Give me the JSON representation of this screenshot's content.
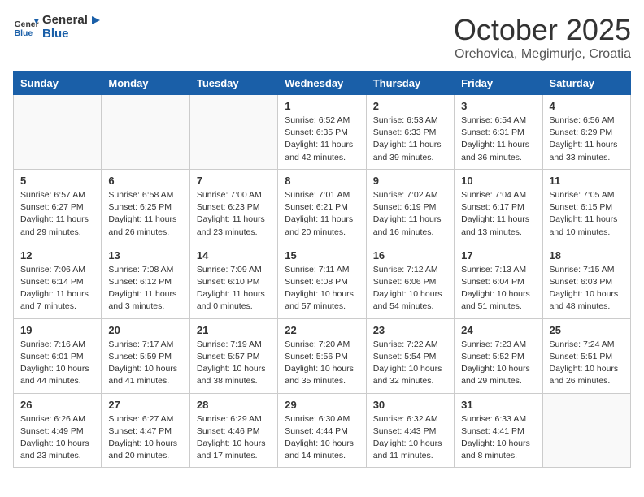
{
  "header": {
    "logo_general": "General",
    "logo_blue": "Blue",
    "month_title": "October 2025",
    "subtitle": "Orehovica, Megimurje, Croatia"
  },
  "days_of_week": [
    "Sunday",
    "Monday",
    "Tuesday",
    "Wednesday",
    "Thursday",
    "Friday",
    "Saturday"
  ],
  "weeks": [
    [
      {
        "day": "",
        "info": ""
      },
      {
        "day": "",
        "info": ""
      },
      {
        "day": "",
        "info": ""
      },
      {
        "day": "1",
        "info": "Sunrise: 6:52 AM\nSunset: 6:35 PM\nDaylight: 11 hours\nand 42 minutes."
      },
      {
        "day": "2",
        "info": "Sunrise: 6:53 AM\nSunset: 6:33 PM\nDaylight: 11 hours\nand 39 minutes."
      },
      {
        "day": "3",
        "info": "Sunrise: 6:54 AM\nSunset: 6:31 PM\nDaylight: 11 hours\nand 36 minutes."
      },
      {
        "day": "4",
        "info": "Sunrise: 6:56 AM\nSunset: 6:29 PM\nDaylight: 11 hours\nand 33 minutes."
      }
    ],
    [
      {
        "day": "5",
        "info": "Sunrise: 6:57 AM\nSunset: 6:27 PM\nDaylight: 11 hours\nand 29 minutes."
      },
      {
        "day": "6",
        "info": "Sunrise: 6:58 AM\nSunset: 6:25 PM\nDaylight: 11 hours\nand 26 minutes."
      },
      {
        "day": "7",
        "info": "Sunrise: 7:00 AM\nSunset: 6:23 PM\nDaylight: 11 hours\nand 23 minutes."
      },
      {
        "day": "8",
        "info": "Sunrise: 7:01 AM\nSunset: 6:21 PM\nDaylight: 11 hours\nand 20 minutes."
      },
      {
        "day": "9",
        "info": "Sunrise: 7:02 AM\nSunset: 6:19 PM\nDaylight: 11 hours\nand 16 minutes."
      },
      {
        "day": "10",
        "info": "Sunrise: 7:04 AM\nSunset: 6:17 PM\nDaylight: 11 hours\nand 13 minutes."
      },
      {
        "day": "11",
        "info": "Sunrise: 7:05 AM\nSunset: 6:15 PM\nDaylight: 11 hours\nand 10 minutes."
      }
    ],
    [
      {
        "day": "12",
        "info": "Sunrise: 7:06 AM\nSunset: 6:14 PM\nDaylight: 11 hours\nand 7 minutes."
      },
      {
        "day": "13",
        "info": "Sunrise: 7:08 AM\nSunset: 6:12 PM\nDaylight: 11 hours\nand 3 minutes."
      },
      {
        "day": "14",
        "info": "Sunrise: 7:09 AM\nSunset: 6:10 PM\nDaylight: 11 hours\nand 0 minutes."
      },
      {
        "day": "15",
        "info": "Sunrise: 7:11 AM\nSunset: 6:08 PM\nDaylight: 10 hours\nand 57 minutes."
      },
      {
        "day": "16",
        "info": "Sunrise: 7:12 AM\nSunset: 6:06 PM\nDaylight: 10 hours\nand 54 minutes."
      },
      {
        "day": "17",
        "info": "Sunrise: 7:13 AM\nSunset: 6:04 PM\nDaylight: 10 hours\nand 51 minutes."
      },
      {
        "day": "18",
        "info": "Sunrise: 7:15 AM\nSunset: 6:03 PM\nDaylight: 10 hours\nand 48 minutes."
      }
    ],
    [
      {
        "day": "19",
        "info": "Sunrise: 7:16 AM\nSunset: 6:01 PM\nDaylight: 10 hours\nand 44 minutes."
      },
      {
        "day": "20",
        "info": "Sunrise: 7:17 AM\nSunset: 5:59 PM\nDaylight: 10 hours\nand 41 minutes."
      },
      {
        "day": "21",
        "info": "Sunrise: 7:19 AM\nSunset: 5:57 PM\nDaylight: 10 hours\nand 38 minutes."
      },
      {
        "day": "22",
        "info": "Sunrise: 7:20 AM\nSunset: 5:56 PM\nDaylight: 10 hours\nand 35 minutes."
      },
      {
        "day": "23",
        "info": "Sunrise: 7:22 AM\nSunset: 5:54 PM\nDaylight: 10 hours\nand 32 minutes."
      },
      {
        "day": "24",
        "info": "Sunrise: 7:23 AM\nSunset: 5:52 PM\nDaylight: 10 hours\nand 29 minutes."
      },
      {
        "day": "25",
        "info": "Sunrise: 7:24 AM\nSunset: 5:51 PM\nDaylight: 10 hours\nand 26 minutes."
      }
    ],
    [
      {
        "day": "26",
        "info": "Sunrise: 6:26 AM\nSunset: 4:49 PM\nDaylight: 10 hours\nand 23 minutes."
      },
      {
        "day": "27",
        "info": "Sunrise: 6:27 AM\nSunset: 4:47 PM\nDaylight: 10 hours\nand 20 minutes."
      },
      {
        "day": "28",
        "info": "Sunrise: 6:29 AM\nSunset: 4:46 PM\nDaylight: 10 hours\nand 17 minutes."
      },
      {
        "day": "29",
        "info": "Sunrise: 6:30 AM\nSunset: 4:44 PM\nDaylight: 10 hours\nand 14 minutes."
      },
      {
        "day": "30",
        "info": "Sunrise: 6:32 AM\nSunset: 4:43 PM\nDaylight: 10 hours\nand 11 minutes."
      },
      {
        "day": "31",
        "info": "Sunrise: 6:33 AM\nSunset: 4:41 PM\nDaylight: 10 hours\nand 8 minutes."
      },
      {
        "day": "",
        "info": ""
      }
    ]
  ]
}
